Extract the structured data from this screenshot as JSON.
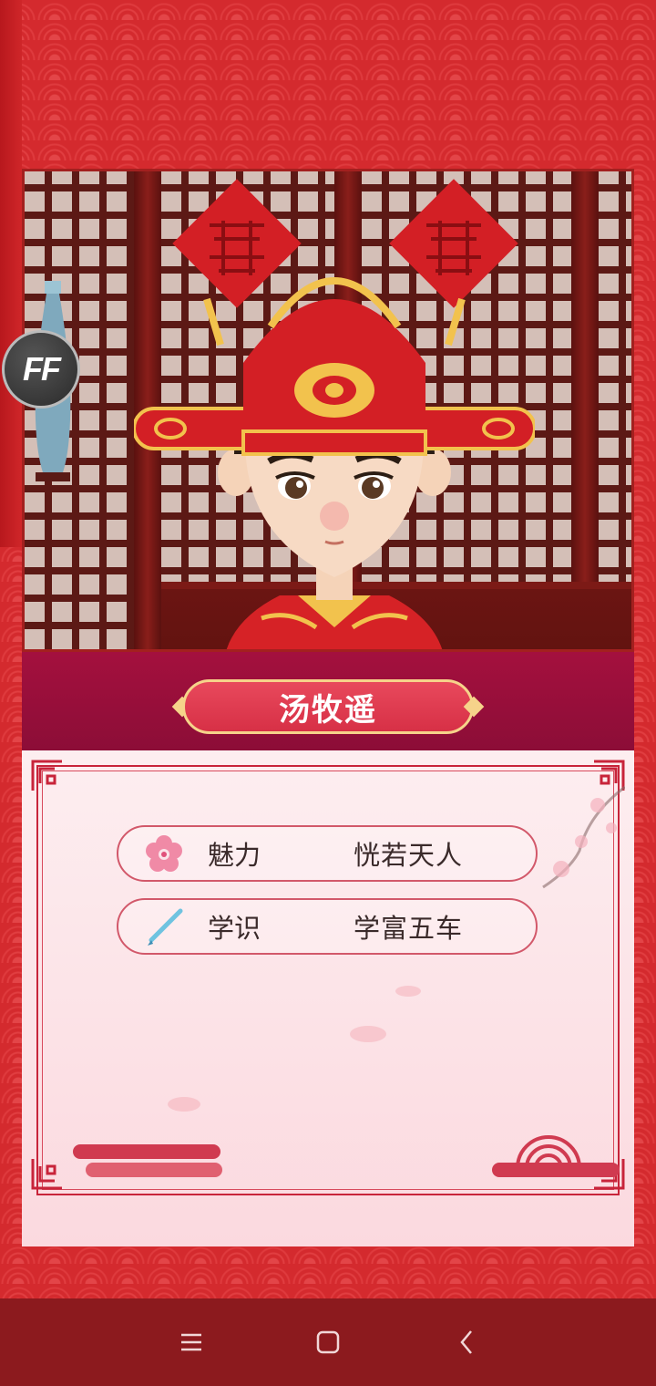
{
  "badge": {
    "text": "FF"
  },
  "character": {
    "name": "汤牧遥"
  },
  "stats": [
    {
      "icon": "plum-blossom-icon",
      "label": "魅力",
      "value": "恍若天人"
    },
    {
      "icon": "brush-icon",
      "label": "学识",
      "value": "学富五车"
    }
  ],
  "navbar": {
    "items": [
      "menu",
      "home",
      "back"
    ]
  },
  "colors": {
    "background": "#d42a2e",
    "name_band": "#a4103e",
    "name_plate": "#d73046",
    "card": "#fdeef0",
    "navbar": "#8c1a1e"
  }
}
